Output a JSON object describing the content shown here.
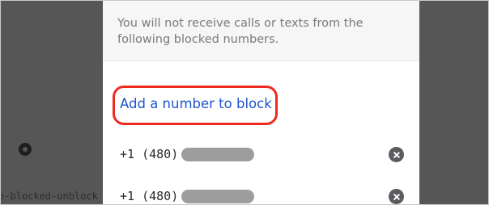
{
  "backdrop": {
    "caption": "e-blocked-unblock",
    "icon": "gear-icon"
  },
  "dialog": {
    "description": "You will not receive calls or texts from the following blocked numbers.",
    "add_link_label": "Add a number to block",
    "blocked_numbers": [
      {
        "prefix": "+1 (480)",
        "remove_icon": "close-circle-icon"
      },
      {
        "prefix": "+1 (480)",
        "remove_icon": "close-circle-icon"
      }
    ]
  },
  "colors": {
    "backdrop": "#565656",
    "link": "#1d56cc",
    "highlight": "#ee2a1e",
    "remove_button": "#5b5b60",
    "redaction": "#9d9d9d"
  }
}
